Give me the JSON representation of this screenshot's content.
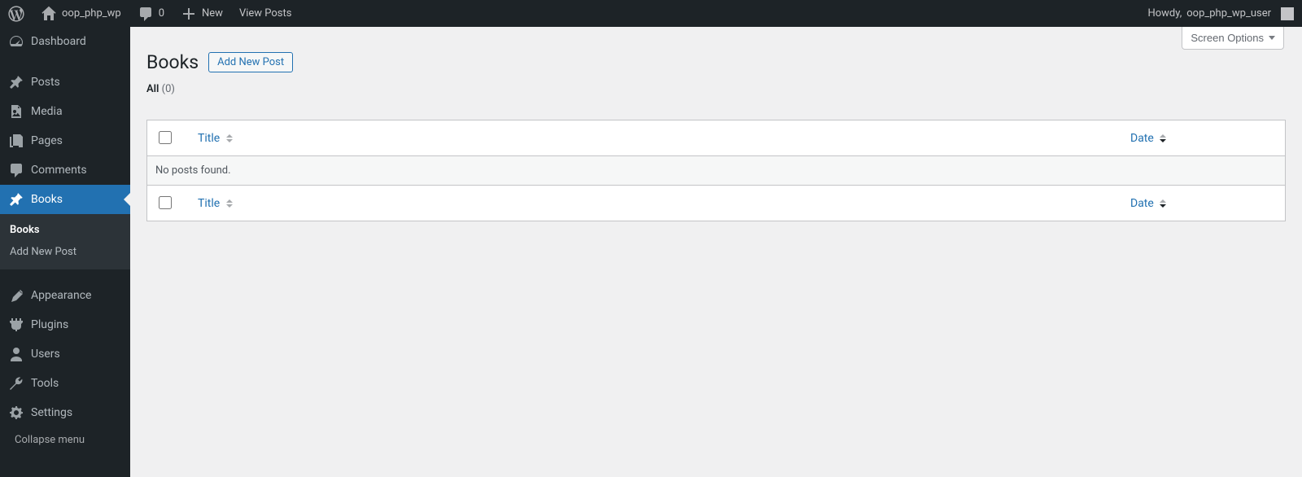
{
  "adminbar": {
    "site_name": "oop_php_wp",
    "comments_count": "0",
    "new_label": "New",
    "view_posts_label": "View Posts",
    "howdy_prefix": "Howdy, ",
    "user_name": "oop_php_wp_user"
  },
  "sidebar": {
    "dashboard": "Dashboard",
    "posts": "Posts",
    "media": "Media",
    "pages": "Pages",
    "comments": "Comments",
    "books": "Books",
    "appearance": "Appearance",
    "plugins": "Plugins",
    "users": "Users",
    "tools": "Tools",
    "settings": "Settings",
    "collapse": "Collapse menu",
    "submenu": {
      "books": "Books",
      "add_new": "Add New Post"
    }
  },
  "screen_options": "Screen Options",
  "page_title": "Books",
  "add_new_post": "Add New Post",
  "filters": {
    "all_label": "All",
    "all_count": "(0)"
  },
  "table": {
    "col_title": "Title",
    "col_date": "Date",
    "no_posts": "No posts found."
  }
}
